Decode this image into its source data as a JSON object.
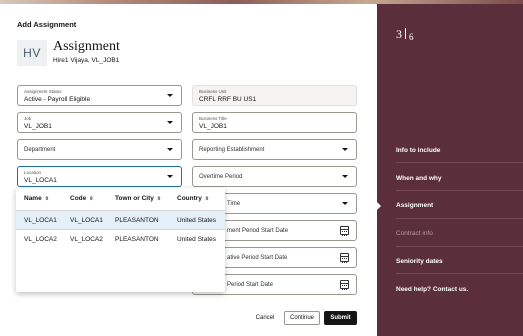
{
  "dialog": {
    "title": "Add Assignment"
  },
  "person": {
    "initials": "HV",
    "heading": "Assignment",
    "subheading": "Hire1 Vijaya, VL_JOB1"
  },
  "fields": {
    "assignment_status": {
      "label": "Assignment Status",
      "value": "Active - Payroll Eligible"
    },
    "business_unit": {
      "label": "Business Unit",
      "value": "CRFL RRF BU US1"
    },
    "job": {
      "label": "Job",
      "value": "VL_JOB1"
    },
    "business_title": {
      "label": "Business Title",
      "value": "VL_JOB1"
    },
    "department": {
      "placeholder": "Department"
    },
    "reporting_establishment": {
      "placeholder": "Reporting Establishment"
    },
    "location": {
      "label": "Location",
      "value": "VL_LOCA1"
    },
    "overtime_period": {
      "placeholder": "Overtime Period"
    },
    "time_partial": {
      "placeholder": "Time"
    },
    "r1": {
      "placeholder": "ment Period Start Date"
    },
    "r2": {
      "placeholder": "ative Period Start Date"
    },
    "r3": {
      "placeholder": "Period Start Date"
    }
  },
  "location_dropdown": {
    "columns": [
      "Name",
      "Code",
      "Town or City",
      "Country"
    ],
    "rows": [
      [
        "VL_LOCA1",
        "VL_LOCA1",
        "PLEASANTON",
        "United States"
      ],
      [
        "VL_LOCA2",
        "VL_LOCA2",
        "PLEASANTON",
        "United States"
      ]
    ]
  },
  "buttons": {
    "cancel": "Cancel",
    "continue": "Continue",
    "submit": "Submit"
  },
  "progress": {
    "current": "3",
    "total": "6"
  },
  "steps": [
    {
      "label": "Info to include",
      "state": "done"
    },
    {
      "label": "When and why",
      "state": "done"
    },
    {
      "label": "Assignment",
      "state": "current"
    },
    {
      "label": "Contract info",
      "state": "disabled"
    },
    {
      "label": "Seniority dates",
      "state": "todo"
    },
    {
      "label": "Need help? Contact us.",
      "state": "todo"
    }
  ],
  "colors": {
    "panel": "#5b2e3b",
    "accent": "#1e6fa8",
    "selected_row": "#e4f0f8"
  }
}
